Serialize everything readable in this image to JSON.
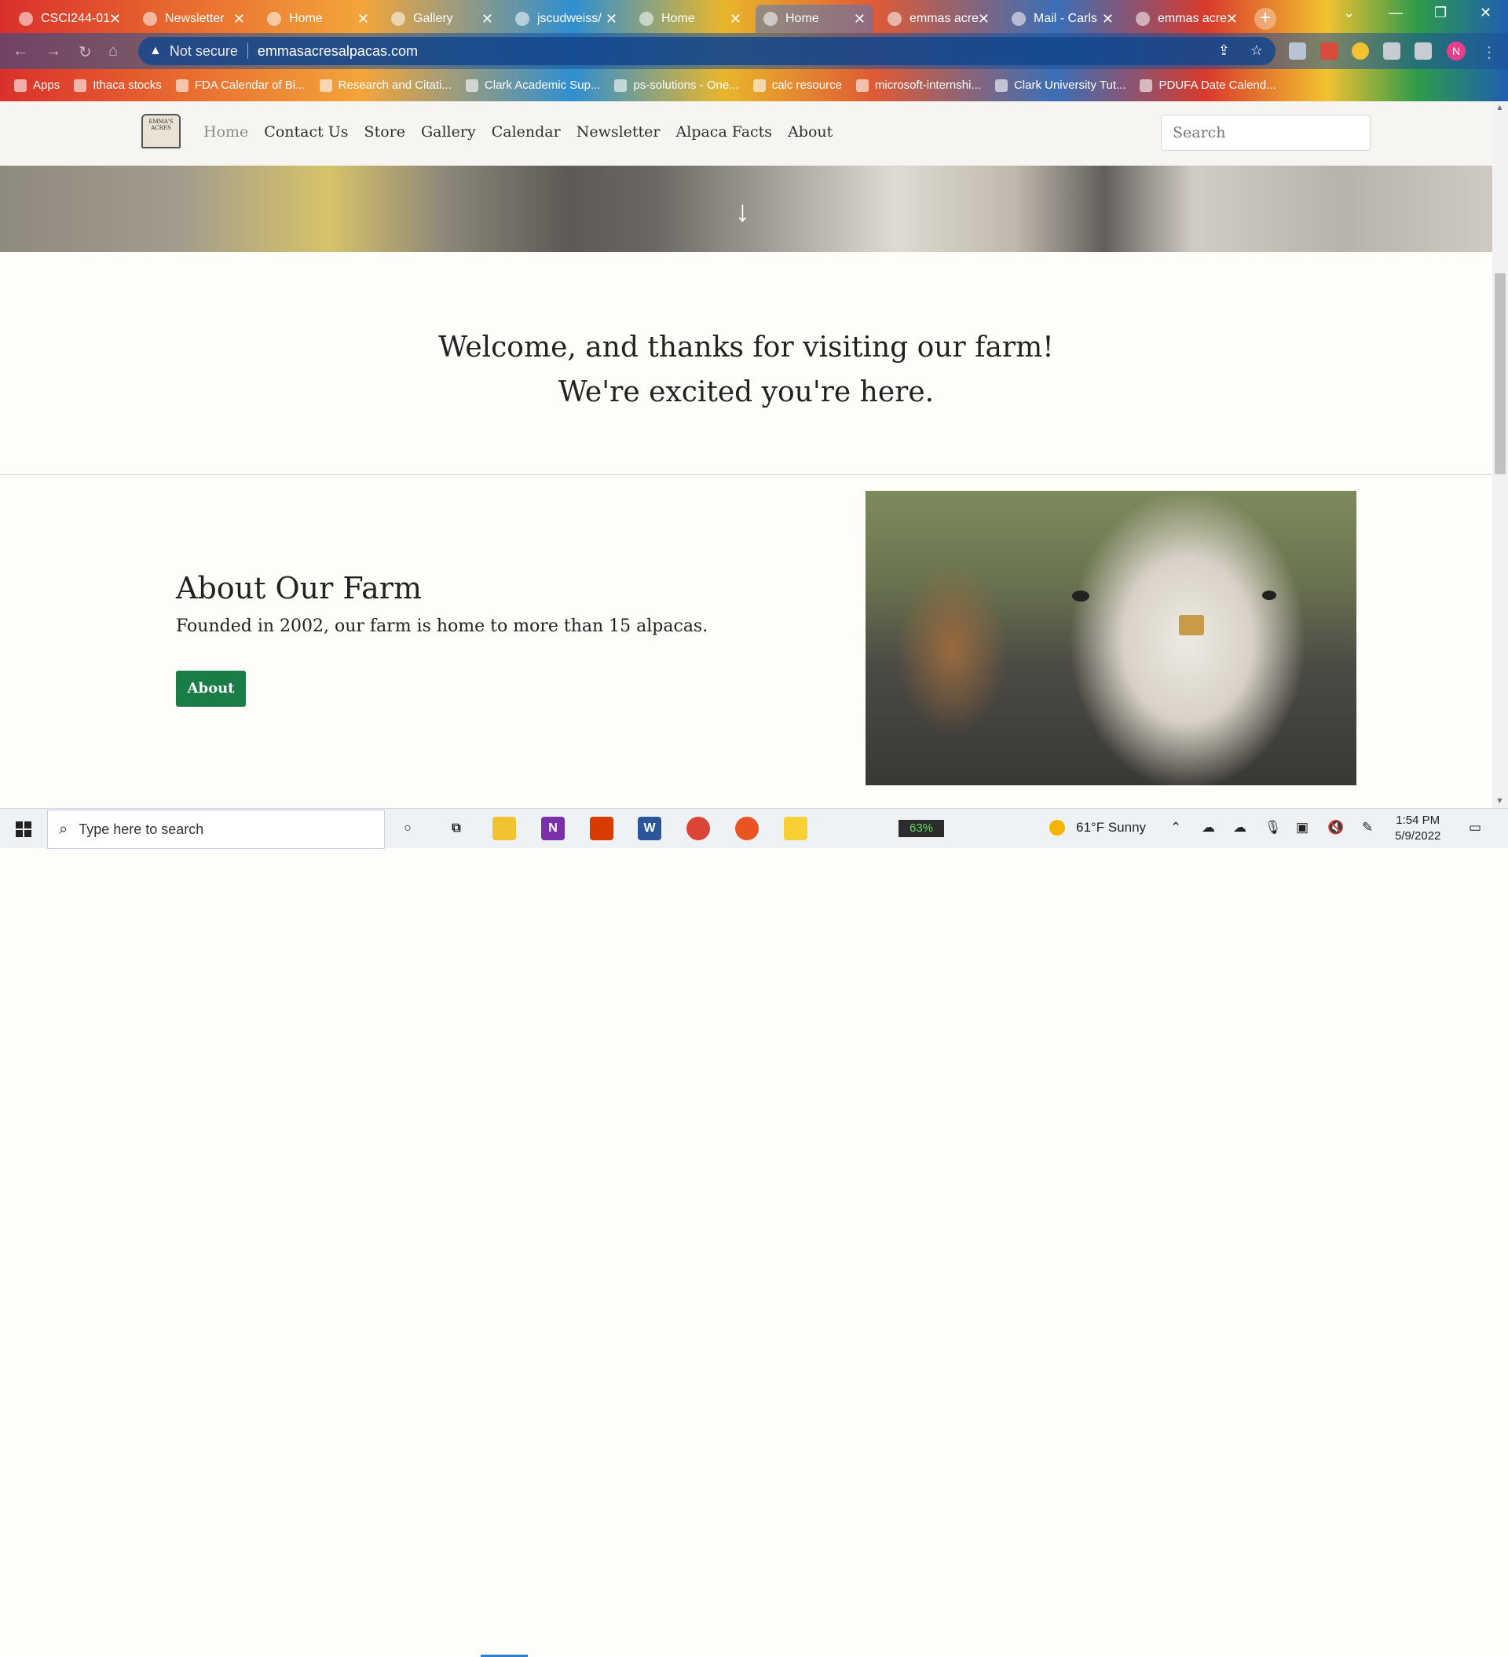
{
  "browser": {
    "tabs": [
      {
        "label": "CSCI244-01",
        "color": "#c9302c"
      },
      {
        "label": "Newsletter",
        "color": "#e06a2f"
      },
      {
        "label": "Home",
        "color": "#e5873a"
      },
      {
        "label": "Gallery",
        "color": "#d8a03a"
      },
      {
        "label": "jscudweiss/",
        "color": "#e9b62b"
      },
      {
        "label": "Home",
        "color": "#de6a35"
      },
      {
        "label": "Home",
        "color": "#5a80c0",
        "active": true
      },
      {
        "label": "emmas acre",
        "color": "#d94a2c"
      },
      {
        "label": "Mail - Carls",
        "color": "#2e6fb8"
      },
      {
        "label": "emmas acre",
        "color": "#d93a2c"
      }
    ],
    "new_tab_symbol": "+",
    "address": {
      "security": "Not secure",
      "url": "emmasacresalpacas.com"
    },
    "profile_initial": "N",
    "bookmarks": [
      "Apps",
      "Ithaca stocks",
      "FDA Calendar of Bi...",
      "Research and Citati...",
      "Clark Academic Sup...",
      "ps-solutions - One...",
      "calc resource",
      "microsoft-internshi...",
      "Clark University Tut...",
      "PDUFA Date Calend..."
    ]
  },
  "site": {
    "logo_text": "EMMA'S ACRES",
    "nav": [
      "Home",
      "Contact Us",
      "Store",
      "Gallery",
      "Calendar",
      "Newsletter",
      "Alpaca Facts",
      "About"
    ],
    "search_placeholder": "Search",
    "welcome_line1": "Welcome, and thanks for visiting our farm!",
    "welcome_line2": "We're excited you're here.",
    "about_title": "About Our Farm",
    "about_text": "Founded in 2002, our farm is home to more than 15 alpacas.",
    "about_button": "About",
    "accent_color": "#1a7d48"
  },
  "taskbar": {
    "search_placeholder": "Type here to search",
    "battery": "63%",
    "weather": "61°F  Sunny",
    "time": "1:54 PM",
    "date": "5/9/2022"
  }
}
